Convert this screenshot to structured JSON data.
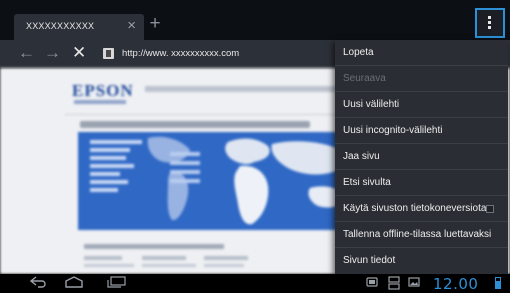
{
  "tab": {
    "title": "XXXXXXXXXXX",
    "close_glyph": "×",
    "new_tab_glyph": "+"
  },
  "toolbar": {
    "back_glyph": "←",
    "forward_glyph": "→",
    "stop_glyph": "✕",
    "url": "http://www. xxxxxxxxxx.com"
  },
  "menu": {
    "items": [
      {
        "label": "Lopeta",
        "enabled": true
      },
      {
        "label": "Seuraava",
        "enabled": false
      },
      {
        "label": "Uusi välilehti",
        "enabled": true
      },
      {
        "label": "Uusi incognito-välilehti",
        "enabled": true
      },
      {
        "label": "Jaa sivu",
        "enabled": true
      },
      {
        "label": "Etsi sivulta",
        "enabled": true
      },
      {
        "label": "Käytä sivuston tietokoneversiota",
        "enabled": true,
        "checkbox": false
      },
      {
        "label": "Tallenna offline-tilassa luettavaksi",
        "enabled": true
      },
      {
        "label": "Sivun tiedot",
        "enabled": true
      }
    ]
  },
  "page": {
    "logo": "EPSON"
  },
  "status": {
    "time": "12.00"
  },
  "icons": {
    "menu": "overflow-menu-icon",
    "back": "back-arrow-icon",
    "forward": "forward-arrow-icon",
    "stop": "stop-icon",
    "nav_back": "nav-back-icon",
    "nav_home": "nav-home-icon",
    "nav_recent": "nav-recent-apps-icon"
  },
  "colors": {
    "accent": "#2d8fd6",
    "menu_bg": "#2a2d33",
    "toolbar_bg": "#2c3038"
  }
}
